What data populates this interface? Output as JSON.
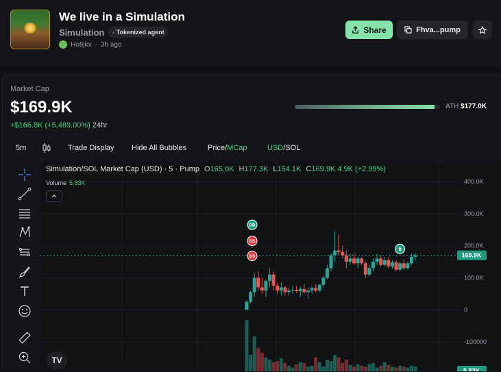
{
  "token": {
    "name": "We live in a Simulation",
    "ticker": "Simulation",
    "badge": "Tokenized agent",
    "creator": "Ho8jkx",
    "age": "3h ago"
  },
  "actions": {
    "share_label": "Share",
    "address_label": "Fhva...pump"
  },
  "market": {
    "label": "Market Cap",
    "value": "$169.9K",
    "change_abs": "+$166.8K",
    "change_pct": "(+5,489.00%)",
    "period": "24hr",
    "ath_label": "ATH",
    "ath_value": "$177.0K",
    "ath_progress": 0.96
  },
  "toolbar": {
    "interval": "5m",
    "trade_display": "Trade Display",
    "hide_bubbles": "Hide All Bubbles",
    "price_label": "Price",
    "mcap_label": "MCap",
    "usd_label": "USD",
    "sol_label": "SOL",
    "separator": "/"
  },
  "legend": {
    "title": "Simulation/SOL Market Cap (USD) · 5 · Pump",
    "o_label": "O",
    "o_value": "165.0K",
    "h_label": "H",
    "h_value": "177.3K",
    "l_label": "L",
    "l_value": "154.1K",
    "c_label": "C",
    "c_value": "169.9K",
    "chg_value": "4.9K (+2.99%)",
    "volume_label": "Volume",
    "volume_value": "5.83K"
  },
  "chart_data": {
    "type": "candlestick",
    "y_ticks": [
      "400.0K",
      "300.0K",
      "200.0K",
      "100.0K",
      "0",
      "-100000"
    ],
    "current_price_label": "169.9K",
    "volume_label_value": "5.83K",
    "ylim": [
      -100000,
      400000
    ],
    "candles": [
      {
        "o": 0,
        "h": 30000,
        "l": 0,
        "c": 25000
      },
      {
        "o": 25000,
        "h": 60000,
        "l": 20000,
        "c": 55000
      },
      {
        "o": 55000,
        "h": 115000,
        "l": 40000,
        "c": 100000
      },
      {
        "o": 100000,
        "h": 120000,
        "l": 60000,
        "c": 70000
      },
      {
        "o": 70000,
        "h": 100000,
        "l": 50000,
        "c": 60000
      },
      {
        "o": 60000,
        "h": 95000,
        "l": 40000,
        "c": 90000
      },
      {
        "o": 90000,
        "h": 130000,
        "l": 70000,
        "c": 110000
      },
      {
        "o": 110000,
        "h": 120000,
        "l": 60000,
        "c": 75000
      },
      {
        "o": 75000,
        "h": 85000,
        "l": 50000,
        "c": 60000
      },
      {
        "o": 60000,
        "h": 85000,
        "l": 45000,
        "c": 70000
      },
      {
        "o": 70000,
        "h": 75000,
        "l": 45000,
        "c": 55000
      },
      {
        "o": 55000,
        "h": 70000,
        "l": 45000,
        "c": 60000
      },
      {
        "o": 60000,
        "h": 75000,
        "l": 50000,
        "c": 62000
      },
      {
        "o": 62000,
        "h": 75000,
        "l": 52000,
        "c": 58000
      },
      {
        "o": 58000,
        "h": 72000,
        "l": 40000,
        "c": 65000
      },
      {
        "o": 65000,
        "h": 80000,
        "l": 50000,
        "c": 55000
      },
      {
        "o": 55000,
        "h": 70000,
        "l": 35000,
        "c": 60000
      },
      {
        "o": 60000,
        "h": 75000,
        "l": 50000,
        "c": 68000
      },
      {
        "o": 68000,
        "h": 80000,
        "l": 55000,
        "c": 60000
      },
      {
        "o": 60000,
        "h": 80000,
        "l": 55000,
        "c": 78000
      },
      {
        "o": 78000,
        "h": 105000,
        "l": 70000,
        "c": 100000
      },
      {
        "o": 100000,
        "h": 140000,
        "l": 95000,
        "c": 130000
      },
      {
        "o": 130000,
        "h": 175000,
        "l": 120000,
        "c": 170000
      },
      {
        "o": 170000,
        "h": 245000,
        "l": 150000,
        "c": 185000
      },
      {
        "o": 185000,
        "h": 235000,
        "l": 170000,
        "c": 180000
      },
      {
        "o": 180000,
        "h": 200000,
        "l": 160000,
        "c": 170000
      },
      {
        "o": 170000,
        "h": 185000,
        "l": 130000,
        "c": 150000
      },
      {
        "o": 150000,
        "h": 175000,
        "l": 140000,
        "c": 160000
      },
      {
        "o": 160000,
        "h": 175000,
        "l": 140000,
        "c": 145000
      },
      {
        "o": 145000,
        "h": 165000,
        "l": 130000,
        "c": 160000
      },
      {
        "o": 160000,
        "h": 165000,
        "l": 140000,
        "c": 145000
      },
      {
        "o": 145000,
        "h": 150000,
        "l": 100000,
        "c": 110000
      },
      {
        "o": 110000,
        "h": 140000,
        "l": 105000,
        "c": 130000
      },
      {
        "o": 130000,
        "h": 160000,
        "l": 120000,
        "c": 150000
      },
      {
        "o": 150000,
        "h": 175000,
        "l": 140000,
        "c": 160000
      },
      {
        "o": 160000,
        "h": 170000,
        "l": 135000,
        "c": 140000
      },
      {
        "o": 140000,
        "h": 165000,
        "l": 135000,
        "c": 155000
      },
      {
        "o": 155000,
        "h": 165000,
        "l": 130000,
        "c": 135000
      },
      {
        "o": 135000,
        "h": 155000,
        "l": 128000,
        "c": 148000
      },
      {
        "o": 148000,
        "h": 155000,
        "l": 120000,
        "c": 125000
      },
      {
        "o": 125000,
        "h": 150000,
        "l": 120000,
        "c": 145000
      },
      {
        "o": 145000,
        "h": 160000,
        "l": 125000,
        "c": 130000
      },
      {
        "o": 130000,
        "h": 150000,
        "l": 125000,
        "c": 145000
      },
      {
        "o": 145000,
        "h": 175000,
        "l": 140000,
        "c": 165000
      },
      {
        "o": 165000,
        "h": 177300,
        "l": 154100,
        "c": 169900
      }
    ],
    "volumes": [
      110,
      35,
      75,
      50,
      40,
      30,
      25,
      20,
      22,
      28,
      18,
      12,
      8,
      15,
      20,
      18,
      10,
      12,
      30,
      20,
      10,
      25,
      22,
      35,
      30,
      18,
      25,
      14,
      10,
      15,
      12,
      10,
      15,
      18,
      8,
      12,
      20,
      14,
      10,
      8,
      12,
      10,
      8,
      12,
      10
    ],
    "bubbles": [
      {
        "label": "DB",
        "type": "buy",
        "candle": 0,
        "value": 265000
      },
      {
        "label": "DS",
        "type": "sell",
        "candle": 0,
        "value": 215000
      },
      {
        "label": "DS",
        "type": "sell",
        "candle": 0,
        "value": 168000
      },
      {
        "label": "B",
        "type": "buy",
        "candle": 40,
        "value": 190000
      }
    ],
    "colors": {
      "up": "#26a69a",
      "down": "#ef5350",
      "accent": "#86e3ab"
    }
  }
}
